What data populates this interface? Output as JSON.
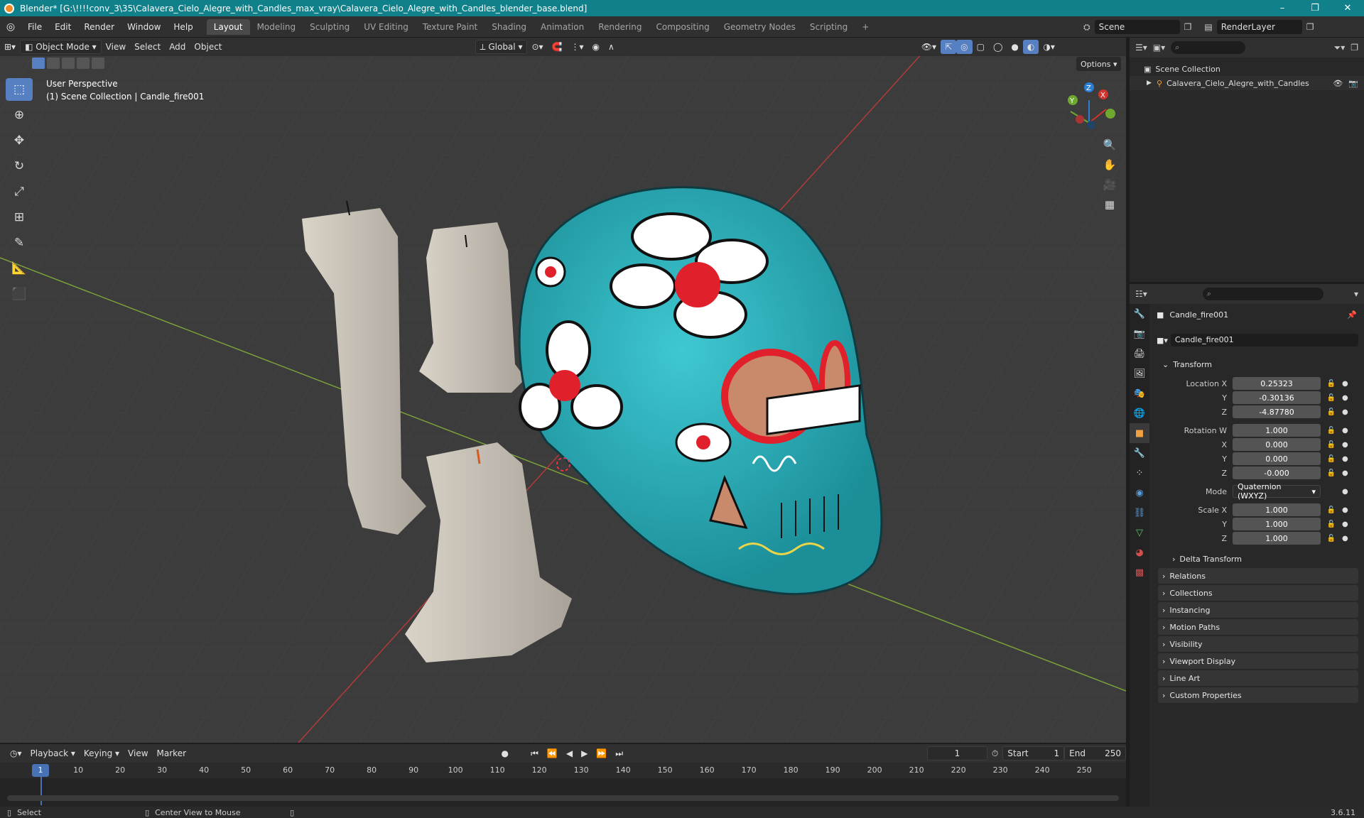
{
  "window": {
    "title": "Blender* [G:\\!!!!conv_3\\35\\Calavera_Cielo_Alegre_with_Candles_max_vray\\Calavera_Cielo_Alegre_with_Candles_blender_base.blend]",
    "minimize": "–",
    "maximize": "❐",
    "close": "✕"
  },
  "menu": [
    "File",
    "Edit",
    "Render",
    "Window",
    "Help"
  ],
  "workspaces": [
    "Layout",
    "Modeling",
    "Sculpting",
    "UV Editing",
    "Texture Paint",
    "Shading",
    "Animation",
    "Rendering",
    "Compositing",
    "Geometry Nodes",
    "Scripting"
  ],
  "workspace_add": "+",
  "scene": {
    "name": "Scene",
    "render_layer": "RenderLayer"
  },
  "viewport": {
    "mode": "Object Mode",
    "menus": [
      "View",
      "Select",
      "Add",
      "Object"
    ],
    "orientation": "Global",
    "options": "Options",
    "info_line1": "User Perspective",
    "info_line2": "(1) Scene Collection | Candle_fire001",
    "gizmo": {
      "x": "X",
      "y": "Y",
      "z": "Z"
    }
  },
  "outliner": {
    "root": "Scene Collection",
    "items": [
      {
        "name": "Calavera_Cielo_Alegre_with_Candles"
      }
    ]
  },
  "properties": {
    "object_name": "Candle_fire001",
    "data_name": "Candle_fire001",
    "transform_header": "Transform",
    "location": {
      "label": "Location X",
      "x": "0.25323",
      "y": "-0.30136",
      "z": "-4.87780"
    },
    "rotation": {
      "label": "Rotation W",
      "w": "1.000",
      "x": "0.000",
      "y": "0.000",
      "z": "-0.000"
    },
    "mode": {
      "label": "Mode",
      "value": "Quaternion (WXYZ)"
    },
    "scale": {
      "label": "Scale X",
      "x": "1.000",
      "y": "1.000",
      "z": "1.000"
    },
    "axis_y": "Y",
    "axis_z": "Z",
    "axis_x": "X",
    "delta": "Delta Transform",
    "sections": [
      "Relations",
      "Collections",
      "Instancing",
      "Motion Paths",
      "Visibility",
      "Viewport Display",
      "Line Art",
      "Custom Properties"
    ]
  },
  "timeline": {
    "menus": [
      "Playback",
      "Keying",
      "View",
      "Marker"
    ],
    "current_frame": "1",
    "start_label": "Start",
    "start": "1",
    "end_label": "End",
    "end": "250",
    "ticks": [
      "1",
      "10",
      "20",
      "30",
      "40",
      "50",
      "60",
      "70",
      "80",
      "90",
      "100",
      "110",
      "120",
      "130",
      "140",
      "150",
      "160",
      "170",
      "180",
      "190",
      "200",
      "210",
      "220",
      "230",
      "240",
      "250"
    ]
  },
  "status": {
    "left": "Select",
    "middle": "Center View to Mouse",
    "version": "3.6.11"
  },
  "colors": {
    "accent": "#5680c2",
    "titlebar": "#10808a",
    "skull": "#2bb5c0"
  }
}
